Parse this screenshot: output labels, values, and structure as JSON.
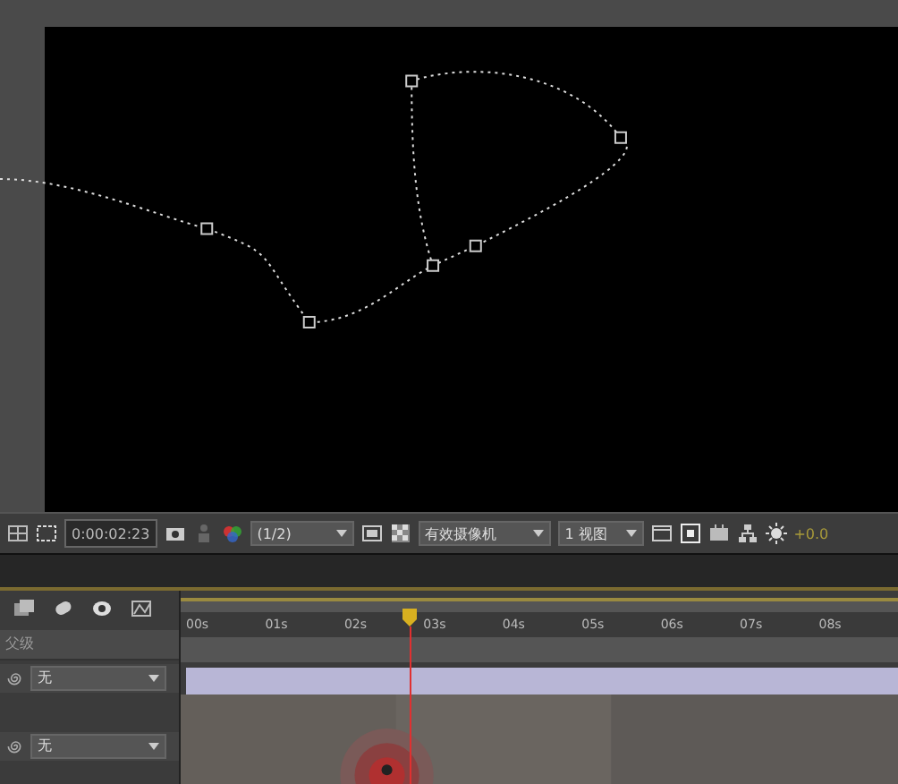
{
  "toolbar": {
    "timecode": "0:00:02:23",
    "resolution": "(1/2)",
    "camera": "有效摄像机",
    "views": "1 视图",
    "exposure": "+0.0"
  },
  "timeline": {
    "ruler": [
      "00s",
      "01s",
      "02s",
      "03s",
      "04s",
      "05s",
      "06s",
      "07s",
      "08s"
    ],
    "parent_header": "父级",
    "layers": [
      {
        "parent": "无"
      },
      {
        "parent": "无"
      }
    ]
  }
}
